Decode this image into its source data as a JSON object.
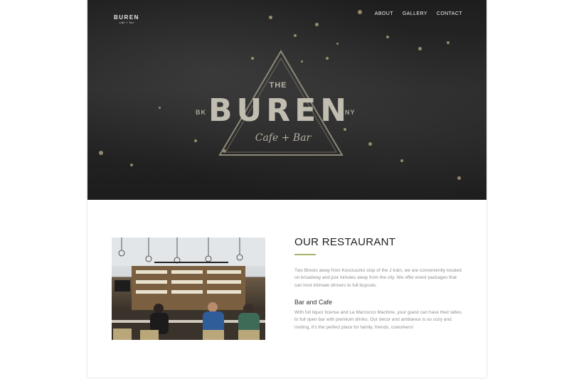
{
  "header": {
    "logo": {
      "name": "BUREN",
      "tagline": "cafe + bar"
    },
    "nav": [
      {
        "label": "ABOUT"
      },
      {
        "label": "GALLERY"
      },
      {
        "label": "CONTACT"
      }
    ]
  },
  "hero": {
    "sign": {
      "the": "THE",
      "name": "BUREN",
      "left": "BK",
      "right": "NY",
      "sub": "Cafe + Bar"
    }
  },
  "restaurant": {
    "heading": "OUR RESTAURANT",
    "intro": "Two Blocks away from Kosciuszko stop of the J train, we are conveniently located on broadway and just minutes away from the city. We offer event packages that can host intimate dinners to full buyouts.",
    "subheading": "Bar and Cafe",
    "body": "With full liquor license and La Marzocco Machine, your guest can have their lattes to full open bar with premium drinks. Our decor and ambiance is so cozy and inviting, it's the perfect place for family, friends, coworkers!"
  },
  "colors": {
    "accent": "#a8b36a",
    "heading": "#222222",
    "body_text": "#8f8f8f",
    "hero_dark": "#1e1e1e"
  }
}
